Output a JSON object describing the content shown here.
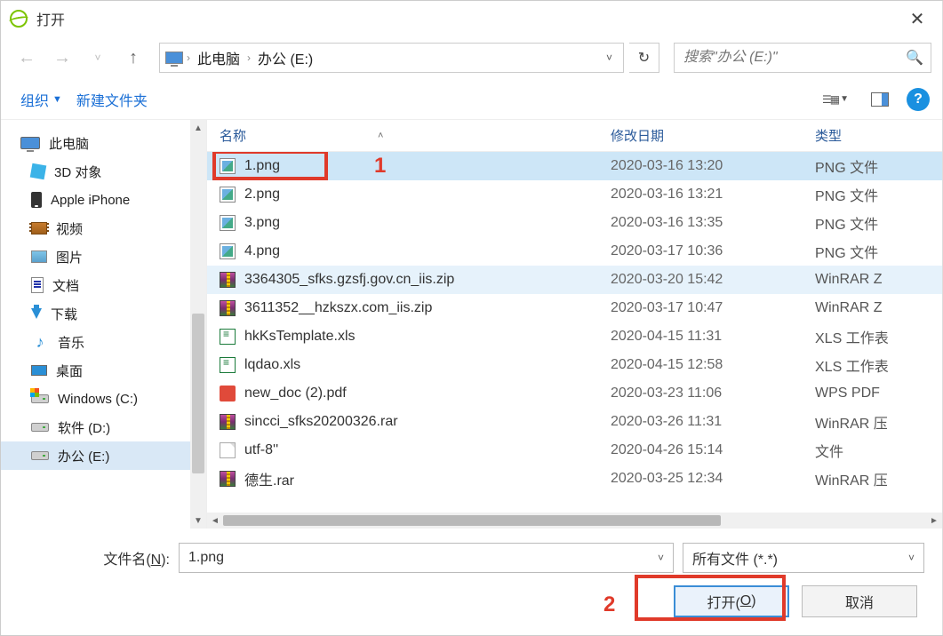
{
  "title": "打开",
  "breadcrumb": {
    "root": "此电脑",
    "current": "办公 (E:)"
  },
  "search": {
    "placeholder": "搜索\"办公 (E:)\""
  },
  "toolbar": {
    "organize": "组织",
    "newfolder": "新建文件夹"
  },
  "sidebar": {
    "root": "此电脑",
    "items": [
      {
        "label": "3D 对象",
        "icon": "cube"
      },
      {
        "label": "Apple iPhone",
        "icon": "phone"
      },
      {
        "label": "视频",
        "icon": "film"
      },
      {
        "label": "图片",
        "icon": "pic"
      },
      {
        "label": "文档",
        "icon": "doc"
      },
      {
        "label": "下载",
        "icon": "down"
      },
      {
        "label": "音乐",
        "icon": "music"
      },
      {
        "label": "桌面",
        "icon": "desk"
      },
      {
        "label": "Windows (C:)",
        "icon": "drive win"
      },
      {
        "label": "软件 (D:)",
        "icon": "drive"
      },
      {
        "label": "办公 (E:)",
        "icon": "drive",
        "selected": true
      }
    ]
  },
  "columns": {
    "name": "名称",
    "date": "修改日期",
    "type": "类型"
  },
  "files": [
    {
      "name": "1.png",
      "date": "2020-03-16 13:20",
      "type": "PNG 文件",
      "icon": "img",
      "selected": true
    },
    {
      "name": "2.png",
      "date": "2020-03-16 13:21",
      "type": "PNG 文件",
      "icon": "img"
    },
    {
      "name": "3.png",
      "date": "2020-03-16 13:35",
      "type": "PNG 文件",
      "icon": "img"
    },
    {
      "name": "4.png",
      "date": "2020-03-17 10:36",
      "type": "PNG 文件",
      "icon": "img"
    },
    {
      "name": "3364305_sfks.gzsfj.gov.cn_iis.zip",
      "date": "2020-03-20 15:42",
      "type": "WinRAR Z",
      "icon": "zip",
      "hover": true
    },
    {
      "name": "3611352__hzkszx.com_iis.zip",
      "date": "2020-03-17 10:47",
      "type": "WinRAR Z",
      "icon": "zip"
    },
    {
      "name": "hkKsTemplate.xls",
      "date": "2020-04-15 11:31",
      "type": "XLS 工作表",
      "icon": "xls"
    },
    {
      "name": "lqdao.xls",
      "date": "2020-04-15 12:58",
      "type": "XLS 工作表",
      "icon": "xls"
    },
    {
      "name": "new_doc (2).pdf",
      "date": "2020-03-23 11:06",
      "type": "WPS PDF",
      "icon": "pdf"
    },
    {
      "name": "sincci_sfks20200326.rar",
      "date": "2020-03-26 11:31",
      "type": "WinRAR 压",
      "icon": "zip"
    },
    {
      "name": "utf-8''",
      "date": "2020-04-26 15:14",
      "type": "文件",
      "icon": "file"
    },
    {
      "name": "德生.rar",
      "date": "2020-03-25 12:34",
      "type": "WinRAR 压",
      "icon": "zip"
    }
  ],
  "bottom": {
    "filename_label_pre": "文件名(",
    "filename_label_u": "N",
    "filename_label_post": "):",
    "filename_value": "1.png",
    "filter": "所有文件 (*.*)",
    "open_pre": "打开(",
    "open_u": "O",
    "open_post": ")",
    "cancel": "取消"
  },
  "annotations": {
    "one": "1",
    "two": "2"
  }
}
